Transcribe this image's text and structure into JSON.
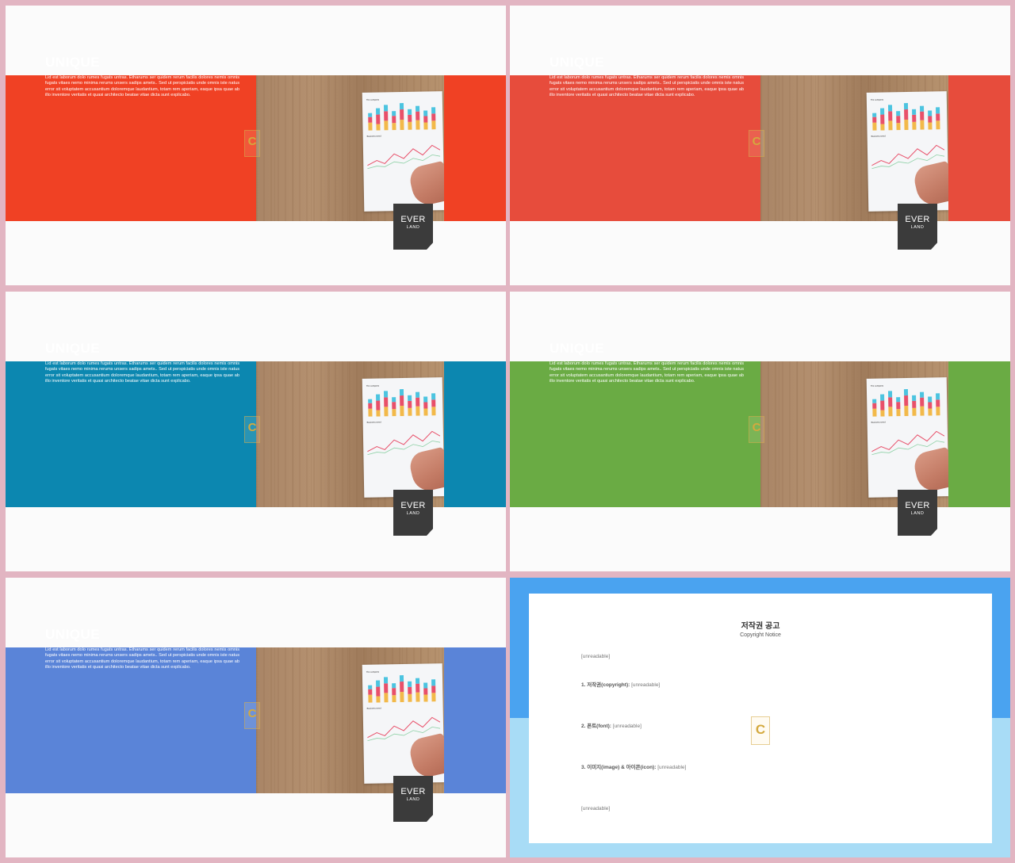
{
  "slides": [
    {
      "title": "UNIQUE",
      "body": "Lid est laborum dolo rumes fugats untras. Etharums ser quidem rerum facilis dolores nemis omnis fugats vitaes nemo minima rerums unsers sadips amets.. Sed ut perspiciatis unde omnis iste natus error sit voluptatem accusantium doloremque laudantium, totam rem aperiam, eaque ipsa quae ab illo inventore veritatis et quasi architecto beatae vitae dicta sunt explicabo.",
      "logo_top": "EVER",
      "logo_bottom": "LAND",
      "accent_color": "#f04124"
    },
    {
      "title": "UNIQUE",
      "body": "Lid est laborum dolo rumes fugats untras. Etharums ser quidem rerum facilis dolores nemis omnis fugats vitaes nemo minima rerums unsers sadips amets.. Sed ut perspiciatis unde omnis iste natus error sit voluptatem accusantium doloremque laudantium, totam rem aperiam, eaque ipsa quae ab illo inventore veritatis et quasi architecto beatae vitae dicta sunt explicabo.",
      "logo_top": "EVER",
      "logo_bottom": "LAND",
      "accent_color": "#e74c3c"
    },
    {
      "title": "UNIQUE",
      "body": "Lid est laborum dolo rumes fugats untras. Etharums ser quidem rerum facilis dolores nemis omnis fugats vitaes nemo minima rerums unsers sadips amets.. Sed ut perspiciatis unde omnis iste natus error sit voluptatem accusantium doloremque laudantium, totam rem aperiam, eaque ipsa quae ab illo inventore veritatis et quasi architecto beatae vitae dicta sunt explicabo.",
      "logo_top": "EVER",
      "logo_bottom": "LAND",
      "accent_color": "#0c87b0"
    },
    {
      "title": "UNIQUE",
      "body": "Lid est laborum dolo rumes fugats untras. Etharums ser quidem rerum facilis dolores nemis omnis fugats vitaes nemo minima rerums unsers sadips amets.. Sed ut perspiciatis unde omnis iste natus error sit voluptatem accusantium doloremque laudantium, totam rem aperiam, eaque ipsa quae ab illo inventore veritatis et quasi architecto beatae vitae dicta sunt explicabo.",
      "logo_top": "EVER",
      "logo_bottom": "LAND",
      "accent_color": "#6aab44"
    },
    {
      "title": "UNIQUE",
      "body": "Lid est laborum dolo rumes fugats untras. Etharums ser quidem rerum facilis dolores nemis omnis fugats vitaes nemo minima rerums unsers sadips amets.. Sed ut perspiciatis unde omnis iste natus error sit voluptatem accusantium doloremque laudantium, totam rem aperiam, eaque ipsa quae ab illo inventore veritatis et quasi architecto beatae vitae dicta sunt explicabo.",
      "logo_top": "EVER",
      "logo_bottom": "LAND",
      "accent_color": "#5a84d8"
    }
  ],
  "watermark_letter": "C",
  "paper_labels": {
    "top": "The company",
    "middle": "Business trend"
  },
  "copyright": {
    "title": "저작권 공고",
    "subtitle": "Copyright Notice",
    "intro": "[unreadable]",
    "item1_label": "1. 저작권(copyright):",
    "item1_text": "[unreadable]",
    "item2_label": "2. 폰트(font):",
    "item2_text": "[unreadable]",
    "item3_label": "3. 이미지(image) & 아이콘(icon):",
    "item3_text": "[unreadable]",
    "footer": "[unreadable]",
    "top_color": "#4aa3f0",
    "bottom_color": "#a8dcf6"
  }
}
